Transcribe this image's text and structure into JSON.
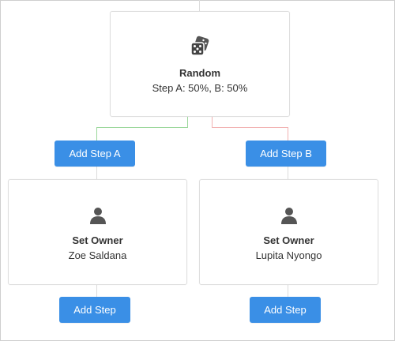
{
  "colors": {
    "button_bg": "#3a8fe6",
    "branch_a_line": "#9ad79a",
    "branch_b_line": "#f2b2b2",
    "neutral_line": "#dcdcdc",
    "icon": "#555555"
  },
  "random_node": {
    "icon": "dice-icon",
    "title": "Random",
    "subtitle": "Step A: 50%, B: 50%"
  },
  "branch_buttons": {
    "a_label": "Add Step A",
    "b_label": "Add Step B"
  },
  "left_node": {
    "icon": "user-icon",
    "title": "Set Owner",
    "subtitle": "Zoe Saldana",
    "add_step_label": "Add Step"
  },
  "right_node": {
    "icon": "user-icon",
    "title": "Set Owner",
    "subtitle": "Lupita Nyongo",
    "add_step_label": "Add Step"
  }
}
